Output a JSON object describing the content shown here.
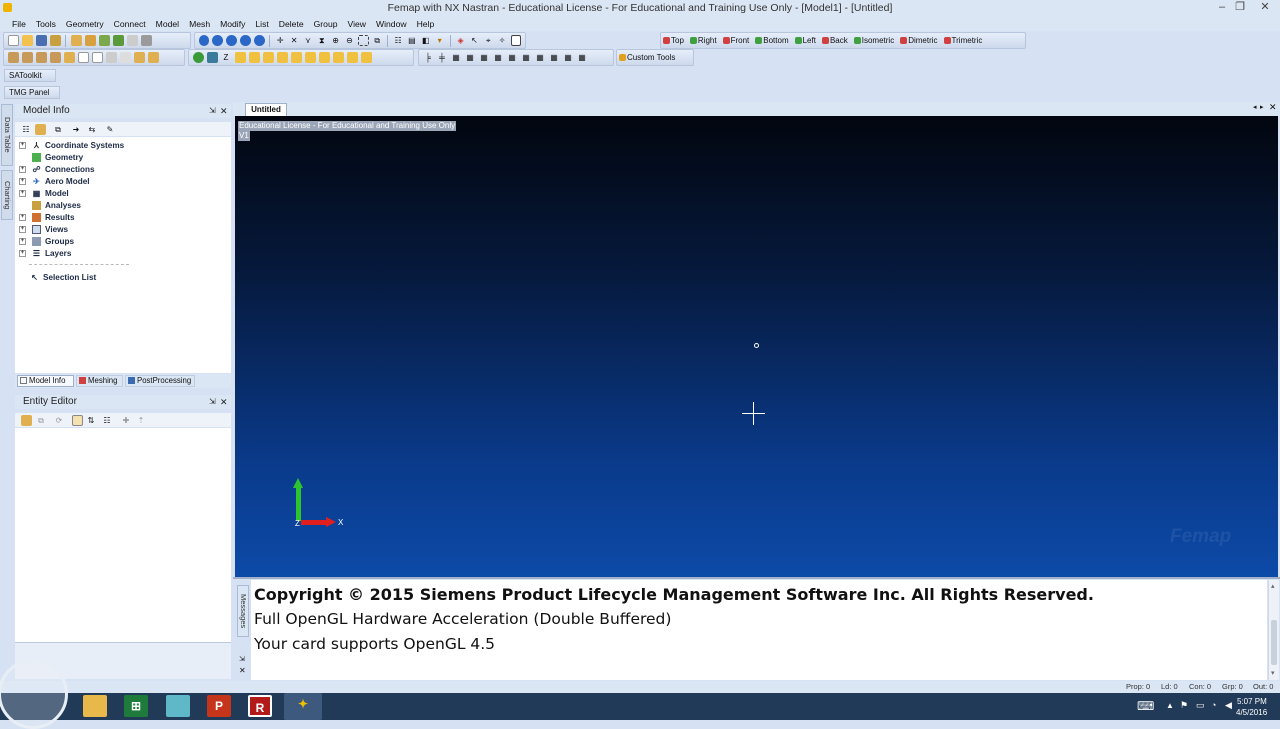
{
  "window": {
    "title": "Femap with NX Nastran - Educational License - For Educational and Training Use Only - [Model1] - [Untitled]"
  },
  "menu": [
    "File",
    "Tools",
    "Geometry",
    "Connect",
    "Model",
    "Mesh",
    "Modify",
    "List",
    "Delete",
    "Group",
    "View",
    "Window",
    "Help"
  ],
  "view_buttons": [
    "Top",
    "Right",
    "Front",
    "Bottom",
    "Left",
    "Back",
    "Isometric",
    "Dimetric",
    "Trimetric"
  ],
  "custom_tools_label": "Custom Tools",
  "toolbars": {
    "satoolkit": "SAToolkit",
    "tmg_panel": "TMG Panel"
  },
  "side_tabs": {
    "data_table": "Data Table",
    "charting": "Charting",
    "messages": "Messages"
  },
  "model_info": {
    "title": "Model Info",
    "tree": [
      "Coordinate Systems",
      "Geometry",
      "Connections",
      "Aero Model",
      "Model",
      "Analyses",
      "Results",
      "Views",
      "Groups",
      "Layers"
    ],
    "selection_list": "Selection List",
    "tabs": [
      "Model Info",
      "Meshing",
      "PostProcessing"
    ]
  },
  "entity_editor": {
    "title": "Entity Editor"
  },
  "viewport": {
    "tab_label": "Untitled",
    "license_banner": "Educational License - For Educational and Training Use Only",
    "view_label": "V1",
    "watermark": "Femap",
    "axis_x": "X",
    "axis_z": "Z"
  },
  "messages": [
    "Copyright © 2015 Siemens Product Lifecycle Management Software Inc. All Rights Reserved.",
    "Full OpenGL Hardware Acceleration (Double Buffered)",
    "Your card supports OpenGL 4.5"
  ],
  "status": {
    "prop": "Prop: 0",
    "ld": "Ld: 0",
    "con": "Con: 0",
    "grp": "Grp: 0",
    "out": "Out: 0"
  },
  "taskbar": {
    "time": "5:07 PM",
    "date": "4/5/2016"
  },
  "colors": {
    "viewport_top": "#02060f",
    "viewport_bottom": "#0c4aa8",
    "chrome": "#dbe6f4",
    "taskbar": "#213a58"
  }
}
